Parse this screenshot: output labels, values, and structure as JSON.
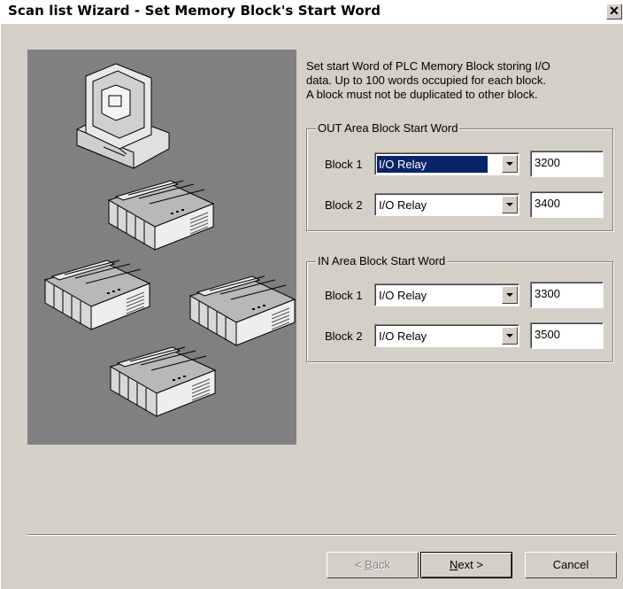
{
  "window": {
    "title": "Scan list Wizard - Set Memory Block's Start Word",
    "close_glyph": "✕"
  },
  "description": {
    "line1": "Set start Word of PLC Memory Block storing I/O",
    "line2": "data. Up to 100 words occupied for each block.",
    "line3": "A block must not be duplicated to other block."
  },
  "out_area": {
    "title": "OUT Area Block Start Word",
    "blocks": [
      {
        "label": "Block 1",
        "type": "I/O Relay",
        "start_word": "3200"
      },
      {
        "label": "Block 2",
        "type": "I/O Relay",
        "start_word": "3400"
      }
    ]
  },
  "in_area": {
    "title": "IN Area Block Start Word",
    "blocks": [
      {
        "label": "Block 1",
        "type": "I/O Relay",
        "start_word": "3300"
      },
      {
        "label": "Block 2",
        "type": "I/O Relay",
        "start_word": "3500"
      }
    ]
  },
  "buttons": {
    "back_mnemonic": "B",
    "back_rest": "ack",
    "back_prefix": "< ",
    "next_mnemonic": "N",
    "next_rest": "ext",
    "next_suffix": " >",
    "cancel": "Cancel"
  },
  "colors": {
    "dialog_bg": "#d4d0c8",
    "picture_bg": "#808080",
    "selection": "#0a246a"
  },
  "icons": [
    "computer-icon",
    "plc-unit-icon"
  ]
}
